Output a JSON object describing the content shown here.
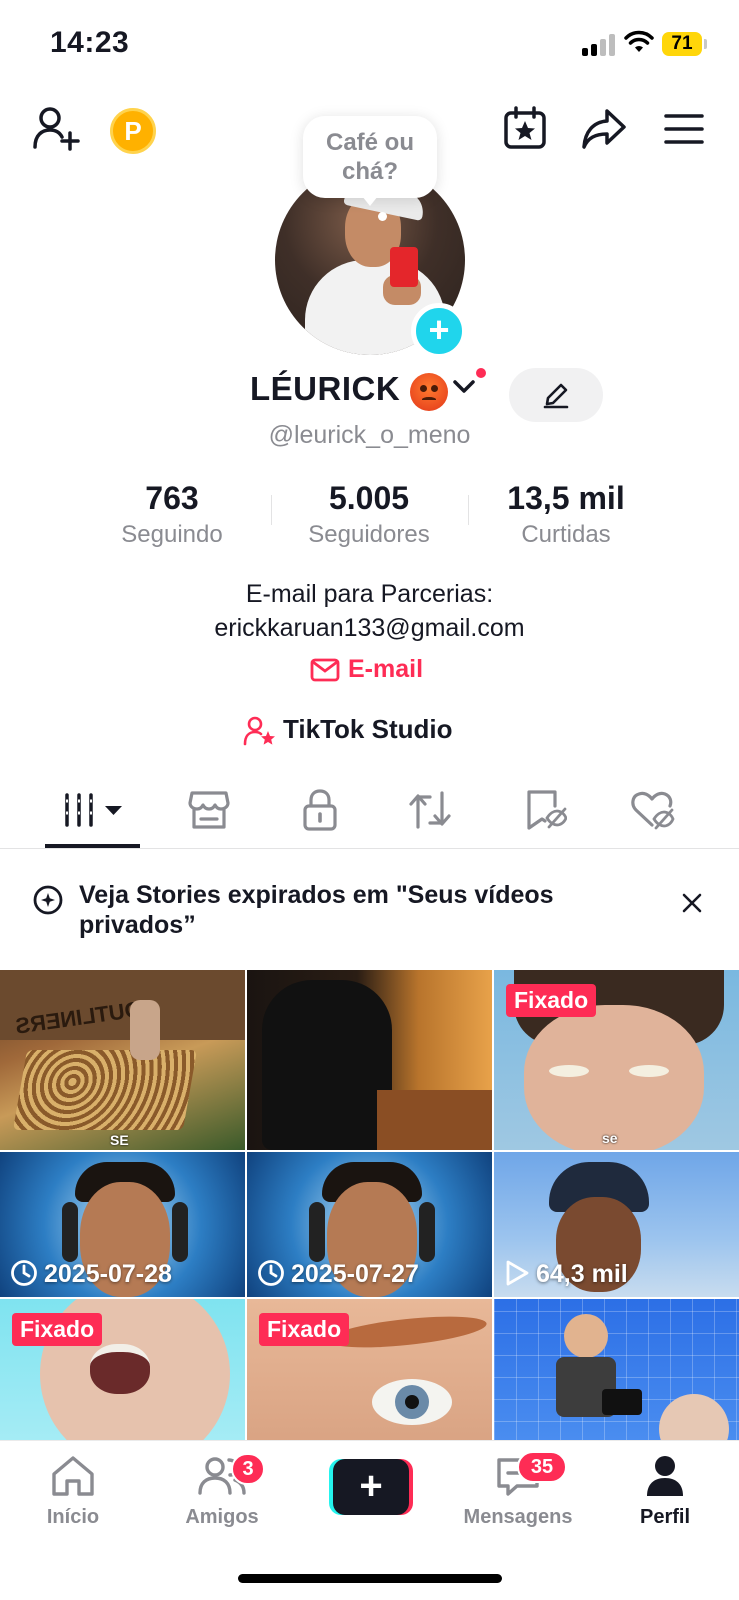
{
  "status_bar": {
    "time": "14:23",
    "battery": "71"
  },
  "top_bar": {
    "coin_letter": "P",
    "icons": [
      "add-friend-icon",
      "coin-icon",
      "calendar-star-icon",
      "share-icon",
      "menu-icon"
    ]
  },
  "profile": {
    "bubble_text": "Café ou chá?",
    "display_name": "LÉURICK",
    "handle": "@leurick_o_meno",
    "avatar_plus": "+",
    "stats": [
      {
        "value": "763",
        "label": "Seguindo"
      },
      {
        "value": "5.005",
        "label": "Seguidores"
      },
      {
        "value": "13,5 mil",
        "label": "Curtidas"
      }
    ],
    "bio_line1": "E-mail para Parcerias:",
    "bio_line2": "erickkaruan133@gmail.com",
    "email_link": "E-mail",
    "studio_link": "TikTok Studio"
  },
  "tabs": [
    "videos-tab",
    "shop-tab",
    "private-tab",
    "reposts-tab",
    "favorites-tab",
    "liked-tab"
  ],
  "banner": {
    "text": "Veja Stories expirados em \"Seus vídeos privados”"
  },
  "grid": {
    "items": [
      {
        "tag": "",
        "overlay": "",
        "mini": "SE"
      },
      {
        "tag": "",
        "overlay": "",
        "mini": ""
      },
      {
        "tag": "Fixado",
        "overlay": "",
        "mini": "se"
      },
      {
        "tag": "",
        "overlay": "2025-07-28",
        "mini": ""
      },
      {
        "tag": "",
        "overlay": "2025-07-27",
        "mini": ""
      },
      {
        "tag": "",
        "overlay": "64,3 mil",
        "mini": ""
      },
      {
        "tag": "Fixado",
        "overlay": "",
        "mini": ""
      },
      {
        "tag": "Fixado",
        "overlay": "",
        "mini": ""
      },
      {
        "tag": "",
        "overlay": "",
        "mini": ""
      }
    ],
    "thumb_text_1": "OUTLINERS"
  },
  "bottom_nav": {
    "home": "Início",
    "friends": "Amigos",
    "friends_badge": "3",
    "create": "+",
    "inbox": "Mensagens",
    "inbox_badge": "35",
    "profile": "Perfil"
  },
  "colors": {
    "accent": "#fe2c55",
    "cyan": "#20d5ec",
    "text": "#161823",
    "muted": "#8a8b91"
  }
}
